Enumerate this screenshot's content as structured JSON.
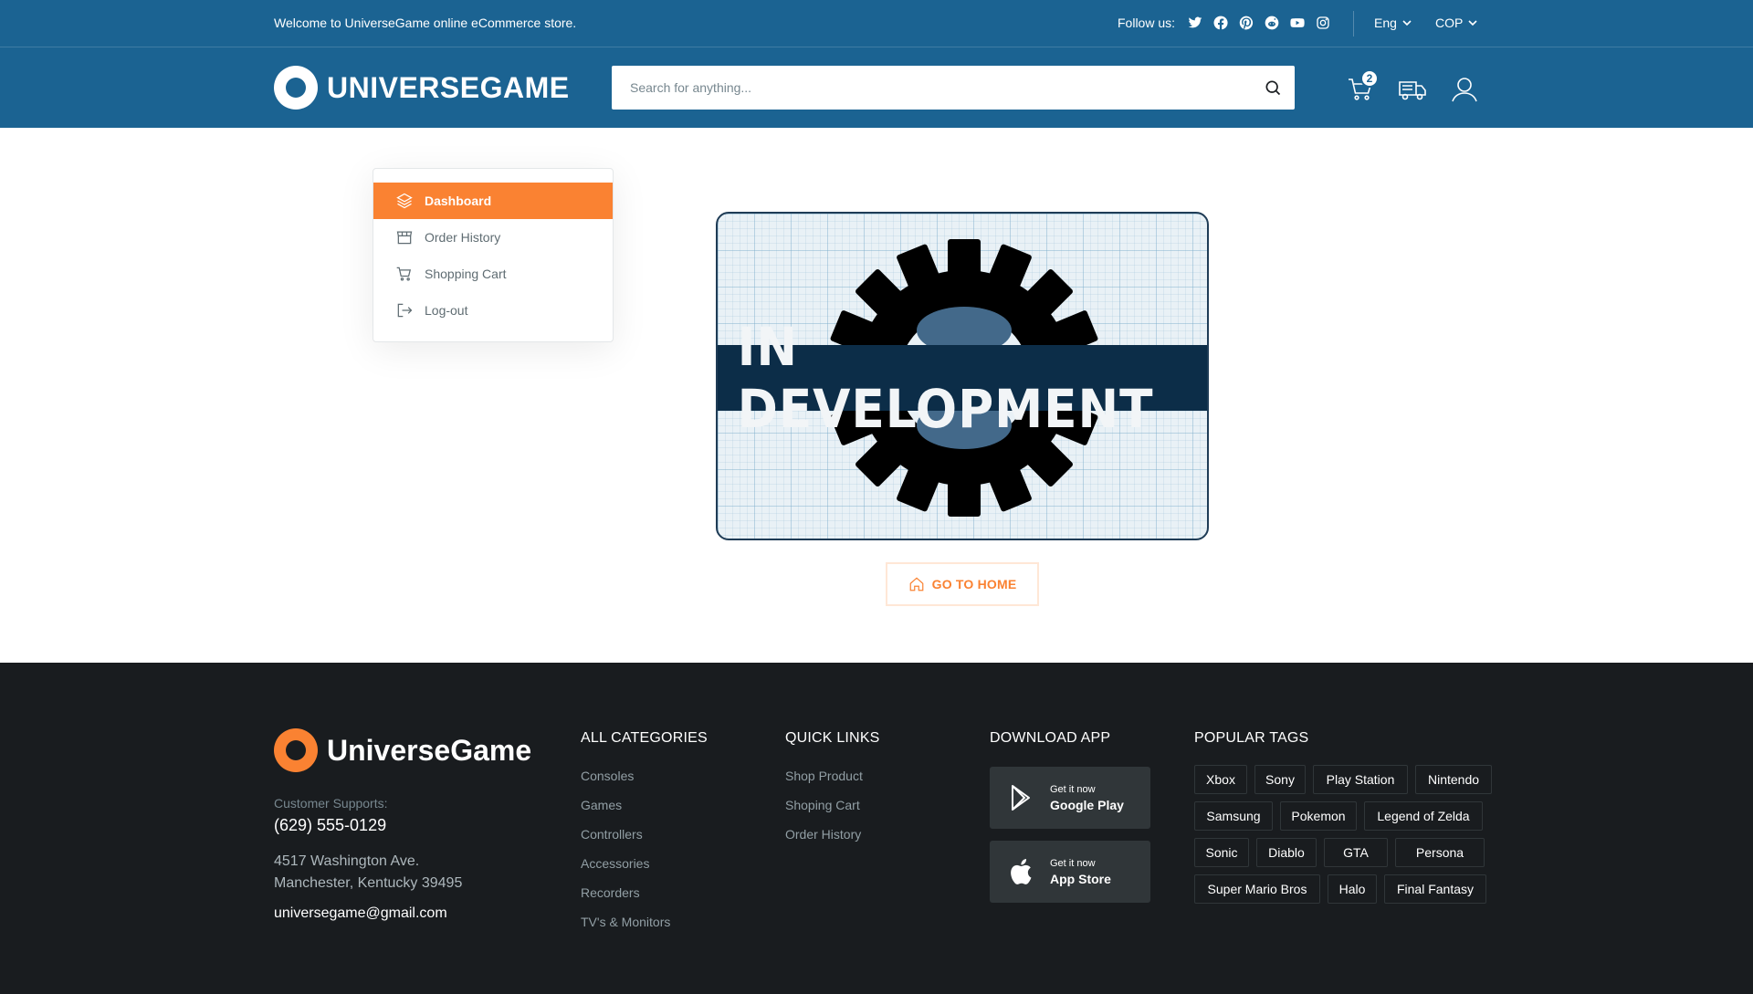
{
  "topbar": {
    "welcome": "Welcome to UniverseGame online eCommerce store.",
    "follow_label": "Follow us:",
    "socials": [
      "twitter-icon",
      "facebook-icon",
      "pinterest-icon",
      "reddit-icon",
      "youtube-icon",
      "instagram-icon"
    ],
    "language": "Eng",
    "currency": "COP"
  },
  "header": {
    "logo_text": "UNIVERSEGAME",
    "search_placeholder": "Search for anything...",
    "cart_count": "2"
  },
  "sidebar": {
    "items": [
      {
        "label": "Dashboard",
        "icon": "stack-icon",
        "active": true
      },
      {
        "label": "Order History",
        "icon": "storefront-icon"
      },
      {
        "label": "Shopping Cart",
        "icon": "cart-icon"
      },
      {
        "label": "Log-out",
        "icon": "logout-icon"
      }
    ]
  },
  "main": {
    "banner_text": "IN DEVELOPMENT",
    "home_button": "GO TO HOME"
  },
  "footer": {
    "logo_text": "UniverseGame",
    "support_label": "Customer Supports:",
    "phone": "(629) 555-0129",
    "address_line1": "4517 Washington Ave.",
    "address_line2": "Manchester, Kentucky 39495",
    "email": "universegame@gmail.com",
    "categories_title": "ALL CATEGORIES",
    "categories": [
      "Consoles",
      "Games",
      "Controllers",
      "Accessories",
      "Recorders",
      "TV's & Monitors"
    ],
    "quick_title": "QUICK LINKS",
    "quick_links": [
      "Shop Product",
      "Shoping Cart",
      "Order History"
    ],
    "download_title": "DOWNLOAD APP",
    "google_small": "Get it now",
    "google_big": "Google Play",
    "apple_small": "Get it now",
    "apple_big": "App Store",
    "tags_title": "POPULAR TAGS",
    "tags": [
      "Xbox",
      "Sony",
      "Play Station",
      "Nintendo",
      "Samsung",
      "Pokemon",
      "Legend of Zelda",
      "Sonic",
      "Diablo",
      "GTA",
      "Persona",
      "Super Mario Bros",
      "Halo",
      "Final Fantasy"
    ]
  },
  "colors": {
    "brand_blue": "#1b6392",
    "accent_orange": "#fa8232",
    "footer_bg": "#191c1f"
  }
}
